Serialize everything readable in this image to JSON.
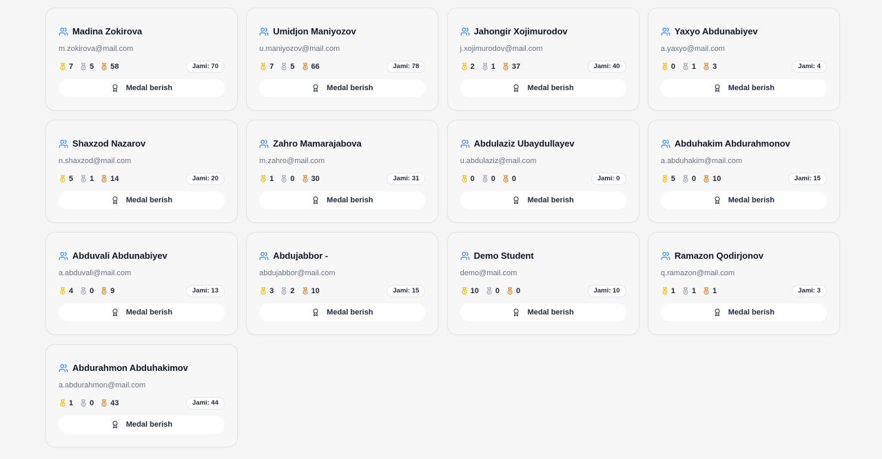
{
  "labels": {
    "total_prefix": "Jami: ",
    "give_medal": "Medal berish"
  },
  "colors": {
    "user_icon": "#3b82f6",
    "gold": "#f5b800",
    "silver": "#9ca3af",
    "bronze": "#e07b27"
  },
  "icons": {
    "user": "users-icon",
    "gold": "gold-medal-icon",
    "silver": "silver-medal-icon",
    "bronze": "bronze-medal-icon",
    "award": "award-icon"
  },
  "students": [
    {
      "name": "Madina Zokirova",
      "email": "m.zokirova@mail.com",
      "gold": "7",
      "silver": "5",
      "bronze": "58",
      "total": "Jami: 70"
    },
    {
      "name": "Umidjon Maniyozov",
      "email": "u.maniyozov@mail.com",
      "gold": "7",
      "silver": "5",
      "bronze": "66",
      "total": "Jami: 78"
    },
    {
      "name": "Jahongir Xojimurodov",
      "email": "j.xojimurodov@mail.com",
      "gold": "2",
      "silver": "1",
      "bronze": "37",
      "total": "Jami: 40"
    },
    {
      "name": "Yaxyo Abdunabiyev",
      "email": "a.yaxyo@mail.com",
      "gold": "0",
      "silver": "1",
      "bronze": "3",
      "total": "Jami: 4"
    },
    {
      "name": "Shaxzod Nazarov",
      "email": "n.shaxzod@mail.com",
      "gold": "5",
      "silver": "1",
      "bronze": "14",
      "total": "Jami: 20"
    },
    {
      "name": "Zahro Mamarajabova",
      "email": "m.zahro@mail.com",
      "gold": "1",
      "silver": "0",
      "bronze": "30",
      "total": "Jami: 31"
    },
    {
      "name": "Abdulaziz Ubaydullayev",
      "email": "u.abdulaziz@mail.com",
      "gold": "0",
      "silver": "0",
      "bronze": "0",
      "total": "Jami: 0"
    },
    {
      "name": "Abduhakim Abdurahmonov",
      "email": "a.abduhakim@mail.com",
      "gold": "5",
      "silver": "0",
      "bronze": "10",
      "total": "Jami: 15"
    },
    {
      "name": "Abduvali Abdunabiyev",
      "email": "a.abduvali@mail.com",
      "gold": "4",
      "silver": "0",
      "bronze": "9",
      "total": "Jami: 13"
    },
    {
      "name": "Abdujabbor -",
      "email": "abdujabbor@mail.com",
      "gold": "3",
      "silver": "2",
      "bronze": "10",
      "total": "Jami: 15"
    },
    {
      "name": "Demo Student",
      "email": "demo@mail.com",
      "gold": "10",
      "silver": "0",
      "bronze": "0",
      "total": "Jami: 10"
    },
    {
      "name": "Ramazon Qodirjonov",
      "email": "q.ramazon@mail.com",
      "gold": "1",
      "silver": "1",
      "bronze": "1",
      "total": "Jami: 3"
    },
    {
      "name": "Abdurahmon Abduhakimov",
      "email": "a.abdurahmon@mail.com",
      "gold": "1",
      "silver": "0",
      "bronze": "43",
      "total": "Jami: 44"
    }
  ]
}
